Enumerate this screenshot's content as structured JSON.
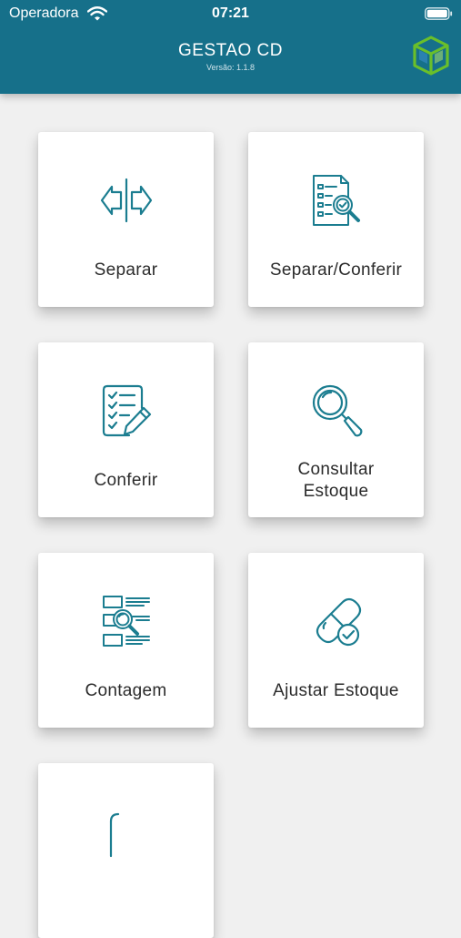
{
  "status_bar": {
    "carrier": "Operadora",
    "time": "07:21"
  },
  "header": {
    "title": "GESTAO CD",
    "version": "Versão: 1.1.8"
  },
  "menu": {
    "separar": "Separar",
    "separar_conferir": "Separar/Conferir",
    "conferir": "Conferir",
    "consultar_estoque_line1": "Consultar",
    "consultar_estoque_line2": "Estoque",
    "contagem": "Contagem",
    "ajustar_estoque": "Ajustar Estoque"
  },
  "colors": {
    "header_bg": "#16708a",
    "icon_teal": "#1b7d90",
    "logo_green": "#6abf2a"
  },
  "icons": {
    "separar": "split-arrows-icon",
    "separar_conferir": "document-search-icon",
    "conferir": "checklist-pencil-icon",
    "consultar_estoque": "magnifier-icon",
    "contagem": "list-magnifier-icon",
    "ajustar_estoque": "capsule-check-icon"
  }
}
